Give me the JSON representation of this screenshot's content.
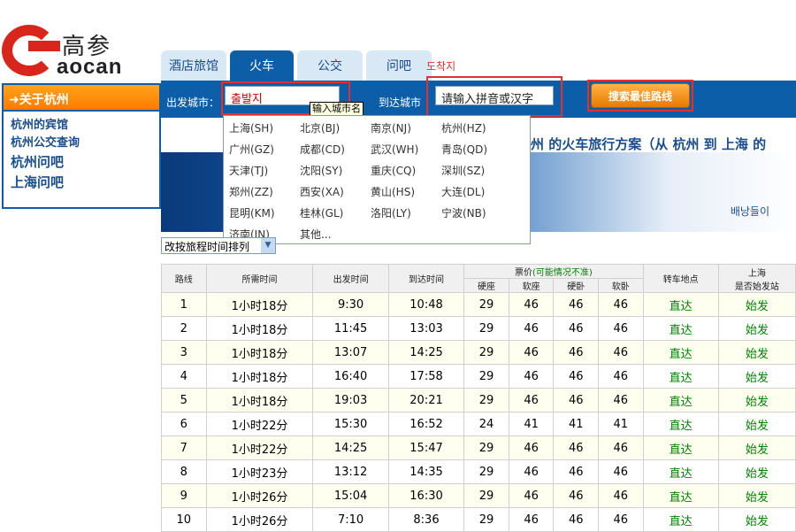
{
  "logo": {
    "cn": "高参",
    "en": "aocan"
  },
  "tabs": [
    "酒店旅馆",
    "火车",
    "公交",
    "问吧"
  ],
  "annotations": {
    "tab_note": "도착지",
    "depart_note": "출발지"
  },
  "search": {
    "depart_label": "出发城市：",
    "arrive_label": "到达城市",
    "arrive_placeholder": "请输入拼音或汉字",
    "button": "搜索最佳路线",
    "tooltip": "输入城市名"
  },
  "sidebar": {
    "header": "关于杭州",
    "links": [
      "杭州的宾馆",
      "杭州公交查询",
      "杭州问吧",
      "上海问吧"
    ]
  },
  "dropdown": [
    [
      "上海(SH)",
      "北京(BJ)",
      "南京(NJ)",
      "杭州(HZ)"
    ],
    [
      "广州(GZ)",
      "成都(CD)",
      "武汉(WH)",
      "青岛(QD)"
    ],
    [
      "天津(TJ)",
      "沈阳(SY)",
      "重庆(CQ)",
      "深圳(SZ)"
    ],
    [
      "郑州(ZZ)",
      "西安(XA)",
      "黄山(HS)",
      "大连(DL)"
    ],
    [
      "昆明(KM)",
      "桂林(GL)",
      "洛阳(LY)",
      "宁波(NB)"
    ],
    [
      "济南(JN)",
      "其他..."
    ]
  ],
  "plan_title": {
    "p1": "州 的火车旅行方案（",
    "p2": "从 杭州 到 上海 的"
  },
  "banner_text": "배낭들이",
  "sort_select": "改按旅程时间排列",
  "table": {
    "headers": [
      "路线",
      "所需时间",
      "出发时间",
      "到达时间",
      "票价",
      "(可能情况不准)",
      "转车地点",
      "上海",
      "是否始发站"
    ],
    "price_cols": [
      "硬座",
      "软座",
      "硬卧",
      "软卧"
    ],
    "rows": [
      [
        "1",
        "1小时18分",
        "9:30",
        "10:48",
        "29",
        "46",
        "46",
        "46",
        "直达",
        "始发"
      ],
      [
        "2",
        "1小时18分",
        "11:45",
        "13:03",
        "29",
        "46",
        "46",
        "46",
        "直达",
        "始发"
      ],
      [
        "3",
        "1小时18分",
        "13:07",
        "14:25",
        "29",
        "46",
        "46",
        "46",
        "直达",
        "始发"
      ],
      [
        "4",
        "1小时18分",
        "16:40",
        "17:58",
        "29",
        "46",
        "46",
        "46",
        "直达",
        "始发"
      ],
      [
        "5",
        "1小时18分",
        "19:03",
        "20:21",
        "29",
        "46",
        "46",
        "46",
        "直达",
        "始发"
      ],
      [
        "6",
        "1小时22分",
        "15:30",
        "16:52",
        "24",
        "41",
        "41",
        "41",
        "直达",
        "始发"
      ],
      [
        "7",
        "1小时22分",
        "14:25",
        "15:47",
        "29",
        "46",
        "46",
        "46",
        "直达",
        "始发"
      ],
      [
        "8",
        "1小时23分",
        "13:12",
        "14:35",
        "29",
        "46",
        "46",
        "46",
        "直达",
        "始发"
      ],
      [
        "9",
        "1小时26分",
        "15:04",
        "16:30",
        "29",
        "46",
        "46",
        "46",
        "直达",
        "始发"
      ],
      [
        "10",
        "1小时26分",
        "7:10",
        "8:36",
        "29",
        "46",
        "46",
        "46",
        "直达",
        "始发"
      ]
    ]
  }
}
